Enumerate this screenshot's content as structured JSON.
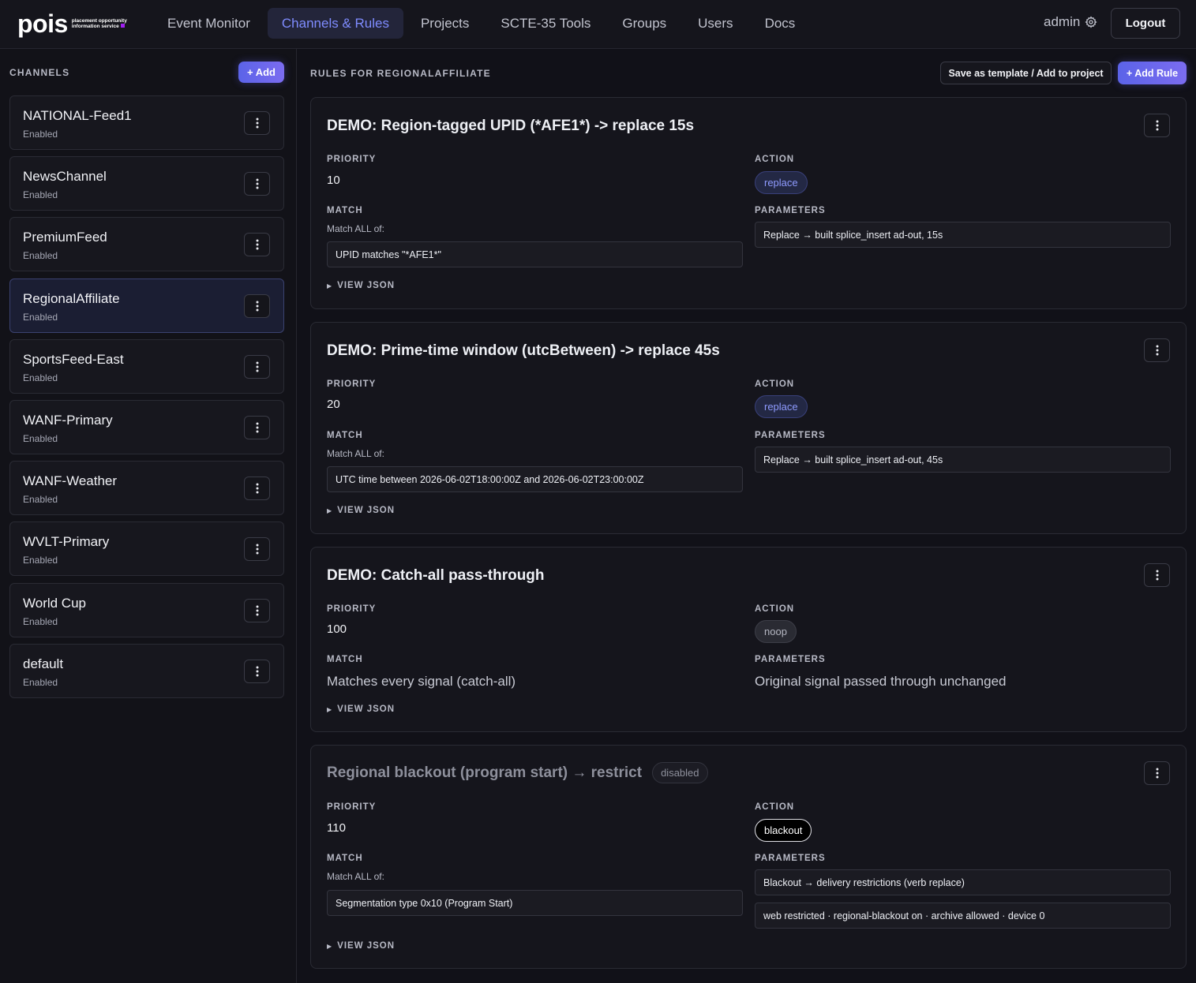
{
  "brand": {
    "logo_text": "pois",
    "tagline_line1": "placement opportunity",
    "tagline_line2": "information service",
    "accent_color": "#a020f0"
  },
  "nav": {
    "items": [
      "Event Monitor",
      "Channels & Rules",
      "Projects",
      "SCTE-35 Tools",
      "Groups",
      "Users",
      "Docs"
    ],
    "active": "Channels & Rules"
  },
  "user": {
    "name": "admin",
    "settings_icon": "gear-icon",
    "logout_label": "Logout"
  },
  "sidebar": {
    "heading": "CHANNELS",
    "add_label": "+ Add",
    "channels": [
      {
        "name": "NATIONAL-Feed1",
        "status": "Enabled"
      },
      {
        "name": "NewsChannel",
        "status": "Enabled"
      },
      {
        "name": "PremiumFeed",
        "status": "Enabled"
      },
      {
        "name": "RegionalAffiliate",
        "status": "Enabled"
      },
      {
        "name": "SportsFeed-East",
        "status": "Enabled"
      },
      {
        "name": "WANF-Primary",
        "status": "Enabled"
      },
      {
        "name": "WANF-Weather",
        "status": "Enabled"
      },
      {
        "name": "WVLT-Primary",
        "status": "Enabled"
      },
      {
        "name": "World Cup",
        "status": "Enabled"
      },
      {
        "name": "default",
        "status": "Enabled"
      }
    ],
    "selected": "RegionalAffiliate"
  },
  "main": {
    "heading": "RULES FOR REGIONALAFFILIATE",
    "save_template_label": "Save as template / Add to project",
    "add_rule_label": "+ Add Rule",
    "labels": {
      "priority": "PRIORITY",
      "action": "ACTION",
      "match": "MATCH",
      "parameters": "PARAMETERS",
      "view_json": "VIEW JSON"
    },
    "rules": [
      {
        "title": "DEMO: Region-tagged UPID (*AFE1*) -> replace 15s",
        "priority": "10",
        "action": "replace",
        "match_mode": "Match ALL of:",
        "match": [
          "UPID matches \"*AFE1*\""
        ],
        "parameters": [
          "Replace → built splice_insert ad-out, 15s"
        ]
      },
      {
        "title": "DEMO: Prime-time window (utcBetween) -> replace 45s",
        "priority": "20",
        "action": "replace",
        "match_mode": "Match ALL of:",
        "match": [
          "UTC time between 2026-06-02T18:00:00Z and 2026-06-02T23:00:00Z"
        ],
        "parameters": [
          "Replace → built splice_insert ad-out, 45s"
        ]
      },
      {
        "title": "DEMO: Catch-all pass-through",
        "priority": "100",
        "action": "noop",
        "match_text": "Matches every signal (catch-all)",
        "parameters_text": "Original signal passed through unchanged"
      },
      {
        "title": "Regional blackout (program start) → restrict",
        "badge": "disabled",
        "priority": "110",
        "action": "blackout",
        "match_mode": "Match ALL of:",
        "match": [
          "Segmentation type 0x10 (Program Start)"
        ],
        "parameters": [
          "Blackout → delivery restrictions (verb replace)",
          "web restricted · regional-blackout on · archive allowed · device 0"
        ]
      }
    ]
  }
}
